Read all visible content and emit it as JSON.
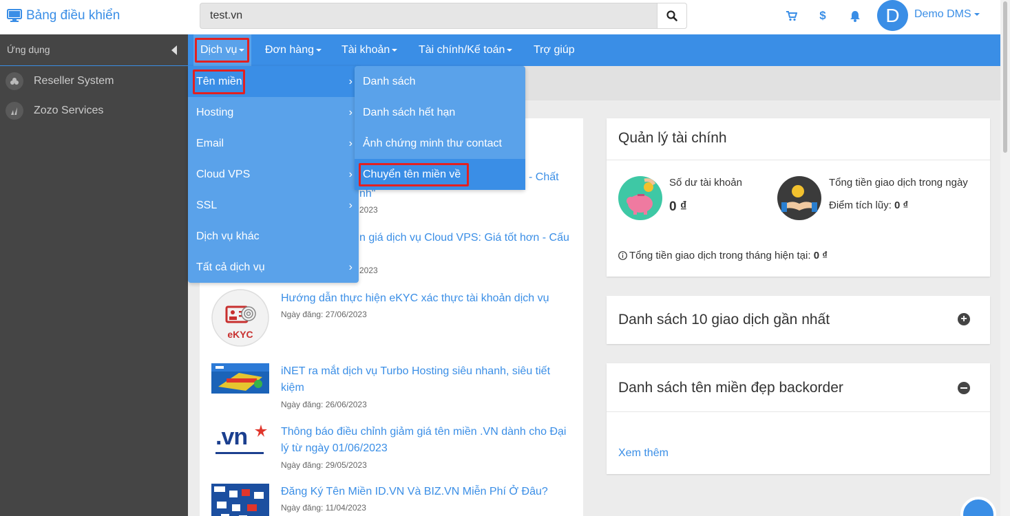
{
  "header": {
    "brand": "Bảng điều khiển",
    "search_value": "test.vn",
    "user_initial": "D",
    "user_name": "Demo DMS"
  },
  "sidebar": {
    "heading": "Ứng dụng",
    "items": [
      {
        "label": "Reseller System",
        "icon": "cloud-cluster-icon"
      },
      {
        "label": "Zozo Services",
        "icon": "leaf-icon"
      }
    ]
  },
  "nav": {
    "items": [
      "Dịch vụ",
      "Đơn hàng",
      "Tài khoản",
      "Tài chính/Kế toán",
      "Trợ giúp"
    ]
  },
  "menu_services": {
    "items": [
      "Tên miền",
      "Hosting",
      "Email",
      "Cloud VPS",
      "SSL",
      "Dịch vụ khác",
      "Tất cả dịch vụ"
    ]
  },
  "menu_domains": {
    "items": [
      "Danh sách",
      "Danh sách hết hạn",
      "Ảnh chứng minh thư contact",
      "Chuyển tên miền về"
    ]
  },
  "news": {
    "partial_1_title": "- Chất",
    "partial_1_title_line2": "nh\"",
    "partial_1_date": "2023",
    "partial_2_title": "n giá dịch vụ Cloud VPS: Giá tốt hơn - Cấu",
    "partial_2_date": "2023",
    "items": [
      {
        "title": "Hướng dẫn thực hiện eKYC xác thực tài khoản dịch vụ",
        "date": "Ngày đăng: 27/06/2023",
        "thumb_text": "eKYC"
      },
      {
        "title": "iNET ra mắt dịch vụ Turbo Hosting siêu nhanh, siêu tiết kiệm",
        "date": "Ngày đăng: 26/06/2023"
      },
      {
        "title": "Thông báo điều chỉnh giảm giá tên miền .VN dành cho Đại lý từ ngày 01/06/2023",
        "date": "Ngày đăng: 29/05/2023",
        "thumb_text": ".vn"
      },
      {
        "title": "Đăng Ký Tên Miền ID.VN Và BIZ.VN Miễn Phí Ở Đâu?",
        "date": "Ngày đăng: 11/04/2023"
      }
    ]
  },
  "finance": {
    "title": "Quản lý tài chính",
    "balance_label": "Số dư tài khoản",
    "balance_value": "0 ₫",
    "daily_label": "Tổng tiền giao dịch trong ngày",
    "points_label": "Điểm tích lũy:",
    "points_value": "0 ₫",
    "monthly_label": "Tổng tiền giao dịch trong tháng hiện tại:",
    "monthly_value": "0 ₫"
  },
  "transactions": {
    "title": "Danh sách 10 giao dịch gần nhất"
  },
  "backorder": {
    "title": "Danh sách tên miền đẹp backorder",
    "more_link": "Xem thêm"
  },
  "colors": {
    "accent": "#3a8ee6",
    "menu": "#5aa2ea",
    "sidebar": "#454545",
    "highlight": "#e32020"
  }
}
